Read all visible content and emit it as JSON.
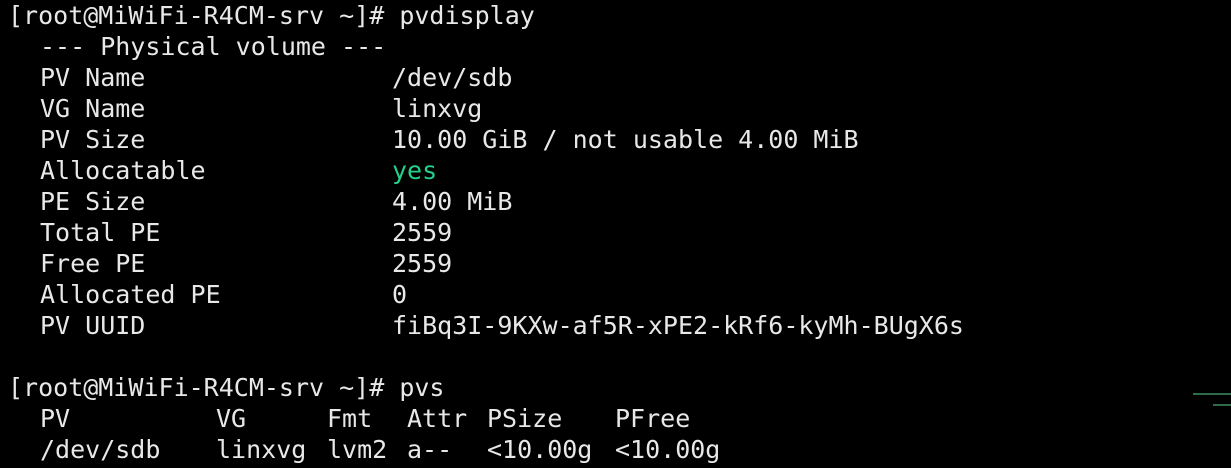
{
  "terminal": {
    "prompt1": "[root@MiWiFi-R4CM-srv ~]# pvdisplay",
    "section_header": "--- Physical volume ---",
    "fields": [
      {
        "key": "PV Name",
        "value": "/dev/sdb"
      },
      {
        "key": "VG Name",
        "value": "linxvg"
      },
      {
        "key": "PV Size",
        "value": "10.00 GiB / not usable 4.00 MiB"
      },
      {
        "key": "Allocatable",
        "value": "yes"
      },
      {
        "key": "PE Size",
        "value": "4.00 MiB"
      },
      {
        "key": "Total PE",
        "value": "2559"
      },
      {
        "key": "Free PE",
        "value": "2559"
      },
      {
        "key": "Allocated PE",
        "value": "0"
      },
      {
        "key": "PV UUID",
        "value": "fiBq3I-9KXw-af5R-xPE2-kRf6-kyMh-BUgX6s"
      }
    ],
    "prompt2": "[root@MiWiFi-R4CM-srv ~]# pvs",
    "pvs_headers": [
      "PV",
      "VG",
      "Fmt",
      "Attr",
      "PSize",
      "PFree"
    ],
    "pvs_row": [
      "/dev/sdb",
      "linxvg",
      "lvm2",
      "a--",
      "<10.00g",
      "<10.00g"
    ],
    "colors": {
      "background": "#000000",
      "text": "#e8e8e8",
      "highlight": "#23d18b"
    }
  }
}
